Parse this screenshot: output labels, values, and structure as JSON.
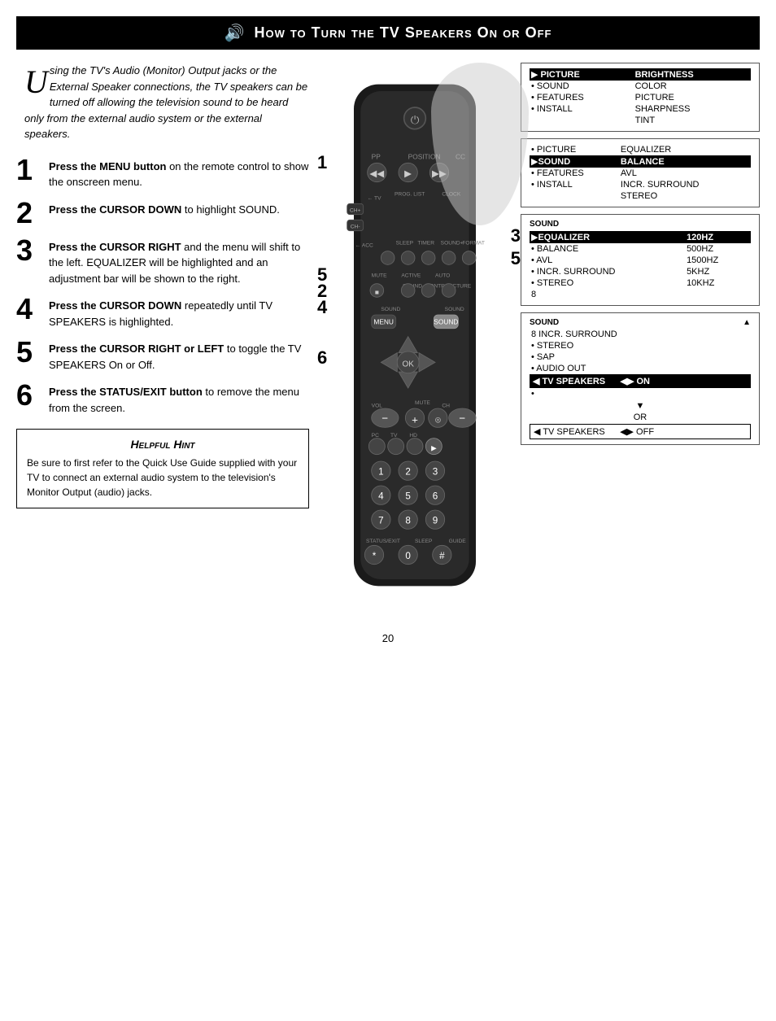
{
  "header": {
    "title": "How to Turn the TV Speakers On or Off",
    "icon": "🔊"
  },
  "intro": {
    "drop_cap": "U",
    "text": "sing the TV's Audio (Monitor) Output jacks or the External Speaker connections, the TV speakers can be turned off allowing the television sound to be heard only from the external audio system or the external speakers."
  },
  "steps": [
    {
      "number": "1",
      "text": "Press the MENU button on the remote control to show the onscreen menu.",
      "bold": "Press the MENU button"
    },
    {
      "number": "2",
      "text": "Press the CURSOR DOWN to highlight SOUND.",
      "bold": "Press the CURSOR DOWN"
    },
    {
      "number": "3",
      "text": "Press the CURSOR RIGHT and the menu will shift to the left. EQUALIZER will be highlighted and an adjustment bar will be shown to the right.",
      "bold": "Press the CURSOR RIGHT"
    },
    {
      "number": "4",
      "text": "Press the CURSOR DOWN repeatedly until TV SPEAKERS is highlighted.",
      "bold": "Press the CURSOR DOWN"
    },
    {
      "number": "5",
      "text": "Press the CURSOR RIGHT or LEFT to toggle the TV SPEAKERS On or Off.",
      "bold": "Press the CURSOR RIGHT or LEFT"
    },
    {
      "number": "6",
      "text": "Press the STATUS/EXIT button to remove the menu from the screen.",
      "bold": "Press the STATUS/EXIT button"
    }
  ],
  "hint": {
    "title": "Helpful Hint",
    "text": "Be sure to first refer to the Quick Use Guide supplied with your TV to connect an external audio system to the television's Monitor Output (audio) jacks."
  },
  "menus": {
    "menu1": {
      "items": [
        {
          "label": "PICTURE",
          "value": "BRIGHTNESS",
          "highlighted": true,
          "bullet": "▶"
        },
        {
          "label": "SOUND",
          "value": "COLOR",
          "highlighted": false,
          "bullet": "•"
        },
        {
          "label": "FEATURES",
          "value": "PICTURE",
          "highlighted": false,
          "bullet": "•"
        },
        {
          "label": "INSTALL",
          "value": "SHARPNESS",
          "highlighted": false,
          "bullet": "•"
        },
        {
          "label": "",
          "value": "TINT",
          "highlighted": false,
          "bullet": ""
        }
      ]
    },
    "menu2": {
      "items": [
        {
          "label": "PICTURE",
          "value": "EQUALIZER",
          "highlighted": false,
          "bullet": "•"
        },
        {
          "label": "SOUND",
          "value": "BALANCE",
          "highlighted": true,
          "bullet": "▶"
        },
        {
          "label": "FEATURES",
          "value": "AVL",
          "highlighted": false,
          "bullet": "•"
        },
        {
          "label": "INSTALL",
          "value": "INCR. SURROUND",
          "highlighted": false,
          "bullet": "•"
        },
        {
          "label": "",
          "value": "STEREO",
          "highlighted": false,
          "bullet": ""
        }
      ]
    },
    "menu3": {
      "header": "SOUND",
      "items": [
        {
          "label": "EQUALIZER",
          "value": "120HZ",
          "highlighted": true,
          "bullet": "▶"
        },
        {
          "label": "BALANCE",
          "value": "500HZ",
          "highlighted": false,
          "bullet": "•"
        },
        {
          "label": "AVL",
          "value": "1500HZ",
          "highlighted": false,
          "bullet": "•"
        },
        {
          "label": "INCR. SURROUND",
          "value": "5KHZ",
          "highlighted": false,
          "bullet": "•"
        },
        {
          "label": "STEREO",
          "value": "10KHZ",
          "highlighted": false,
          "bullet": "•"
        },
        {
          "label": "8",
          "value": "",
          "highlighted": false,
          "bullet": ""
        }
      ]
    },
    "menu4": {
      "header": "SOUND",
      "arrow": "▲",
      "items": [
        {
          "label": "INCR. SURROUND",
          "value": "",
          "highlighted": false,
          "bullet": "8"
        },
        {
          "label": "STEREO",
          "value": "",
          "highlighted": false,
          "bullet": "•"
        },
        {
          "label": "SAP",
          "value": "",
          "highlighted": false,
          "bullet": "•"
        },
        {
          "label": "AUDIO OUT",
          "value": "",
          "highlighted": false,
          "bullet": "•"
        },
        {
          "label": "TV SPEAKERS",
          "value": "◀▶ ON",
          "highlighted": true,
          "bullet": "◀"
        },
        {
          "label": "•",
          "value": "",
          "highlighted": false,
          "bullet": ""
        }
      ],
      "arrow_down": "▼",
      "or_text": "OR",
      "last_item": {
        "label": "TV SPEAKERS",
        "value": "◀▶ OFF",
        "highlighted": false,
        "bullet": "◀"
      }
    }
  },
  "page_number": "20"
}
